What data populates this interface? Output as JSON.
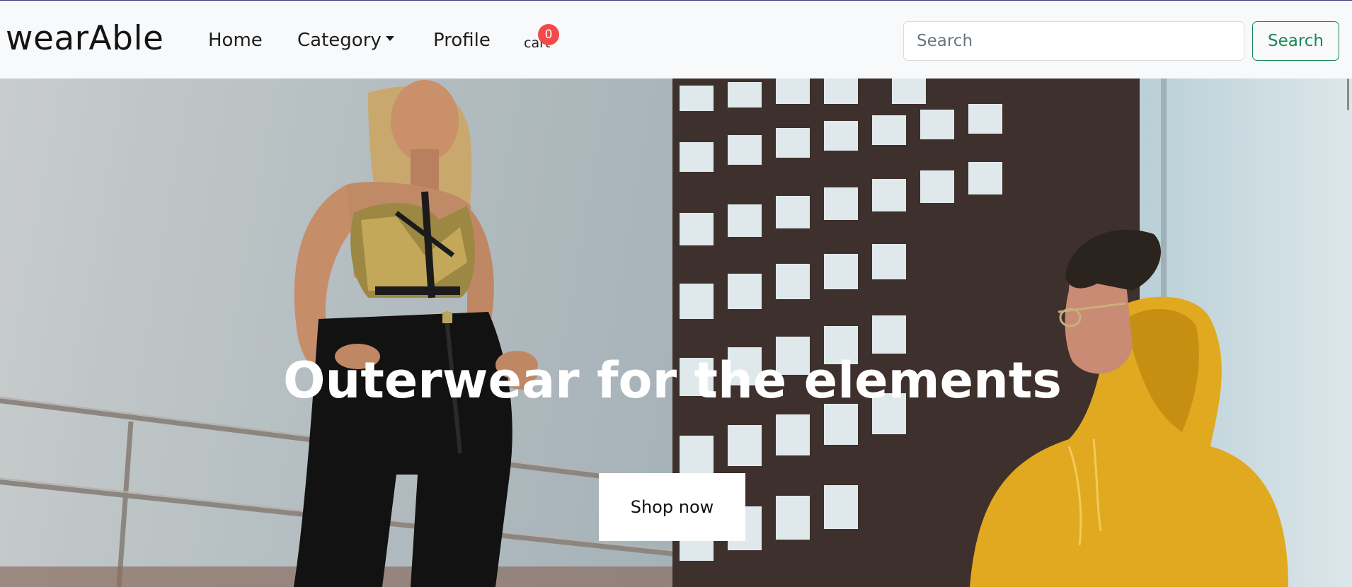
{
  "navbar": {
    "brand": "wearAble",
    "links": {
      "home": "Home",
      "category": "Category",
      "profile": "Profile"
    },
    "cart": {
      "label": "cart",
      "count": "0"
    },
    "search": {
      "placeholder": "Search",
      "value": "",
      "button_label": "Search"
    }
  },
  "hero": {
    "title": "Outerwear for the elements",
    "cta_label": "Shop now",
    "images": {
      "left": "woman-in-sequin-top-and-black-cargo-pants-photo",
      "right": "man-in-yellow-hoodie-in-front-of-building-photo"
    }
  },
  "colors": {
    "navbar_bg": "#f8f9fa",
    "search_button": "#198754",
    "cart_badge": "#f14a4a",
    "hero_title": "#ffffff",
    "hoodie_yellow": "#e1a91f"
  }
}
